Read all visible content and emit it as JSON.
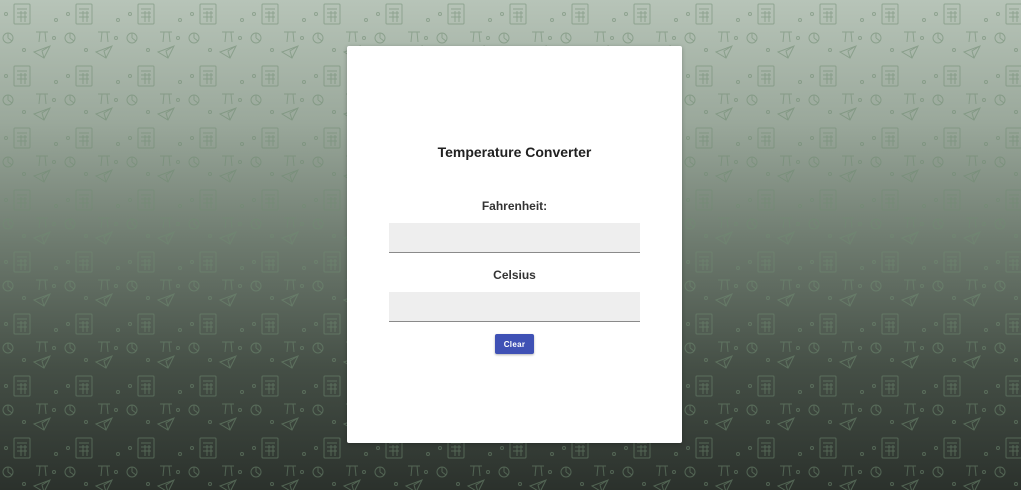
{
  "app": {
    "title": "Temperature Converter"
  },
  "form": {
    "fahrenheit_label": "Fahrenheit:",
    "fahrenheit_value": "",
    "celsius_label": "Celsius",
    "celsius_value": "",
    "clear_label": "Clear"
  },
  "colors": {
    "accent": "#3f51b5",
    "card": "#ffffff",
    "field_bg": "#eeeeee",
    "pattern": "#6e8a70"
  },
  "icons": {
    "background": [
      "calculator-icon",
      "pi-icon",
      "pie-chart-icon",
      "paper-plane-icon"
    ]
  }
}
